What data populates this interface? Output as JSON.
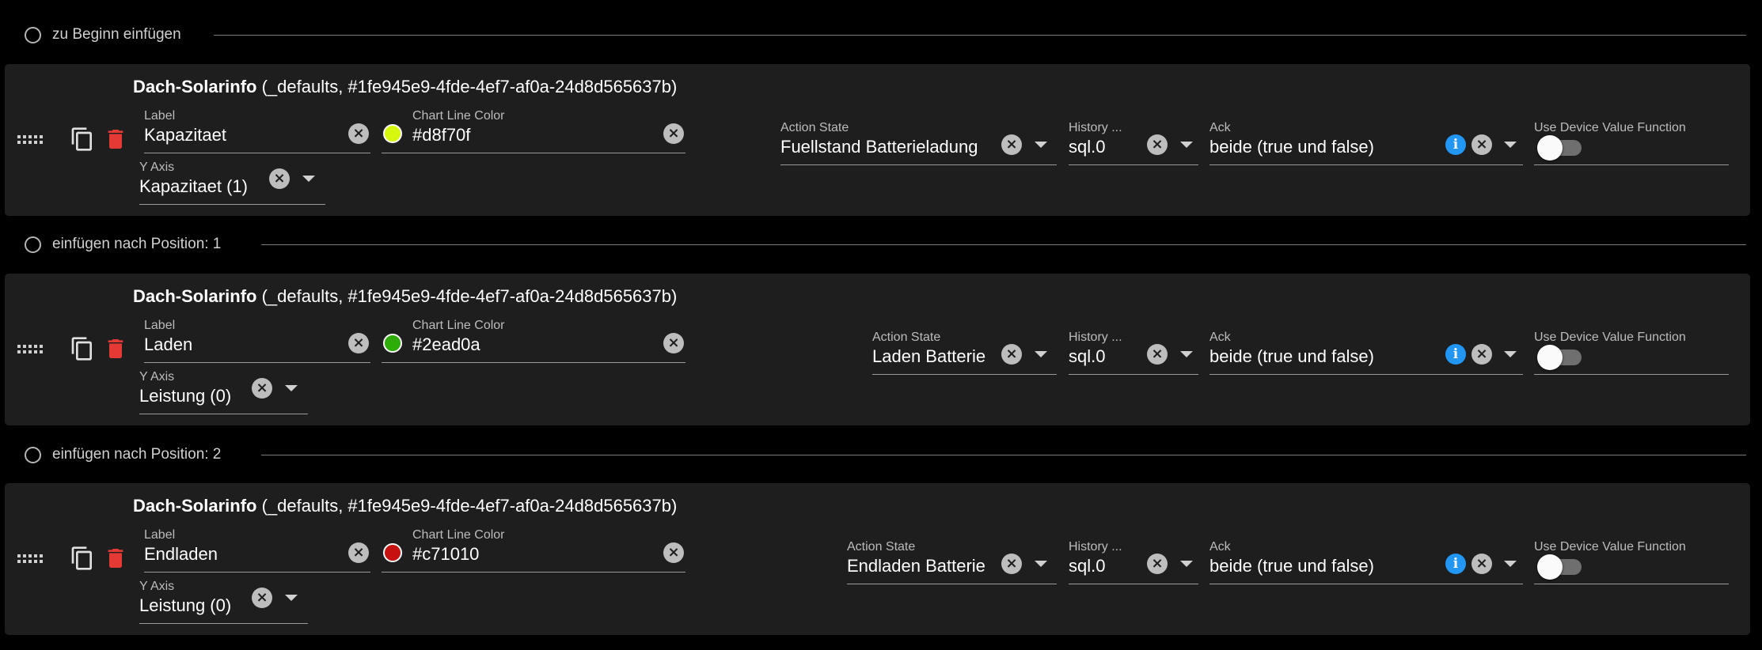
{
  "insert_rows": [
    {
      "label": "zu Beginn einfügen"
    },
    {
      "label": "einfügen nach Position: 1"
    },
    {
      "label": "einfügen nach Position: 2"
    }
  ],
  "cards": [
    {
      "title_name": "Dach-Solarinfo",
      "title_rest": " (_defaults, #1fe945e9-4fde-4ef7-af0a-24d8d565637b)",
      "label_caption": "Label",
      "label_value": "Kapazitaet",
      "color_caption": "Chart Line Color",
      "color_value": "#d8f70f",
      "yaxis_caption": "Y Axis",
      "yaxis_value": "Kapazitaet (1)",
      "action_caption": "Action State",
      "action_value": "Fuellstand Batterieladung",
      "history_caption": "History ...",
      "history_value": "sql.0",
      "ack_caption": "Ack",
      "ack_value": "beide (true und false)",
      "udvf_caption": "Use Device Value Function",
      "udvf_on": false
    },
    {
      "title_name": "Dach-Solarinfo",
      "title_rest": " (_defaults, #1fe945e9-4fde-4ef7-af0a-24d8d565637b)",
      "label_caption": "Label",
      "label_value": "Laden",
      "color_caption": "Chart Line Color",
      "color_value": "#2ead0a",
      "yaxis_caption": "Y Axis",
      "yaxis_value": "Leistung (0)",
      "action_caption": "Action State",
      "action_value": "Laden Batterie",
      "history_caption": "History ...",
      "history_value": "sql.0",
      "ack_caption": "Ack",
      "ack_value": "beide (true und false)",
      "udvf_caption": "Use Device Value Function",
      "udvf_on": false
    },
    {
      "title_name": "Dach-Solarinfo",
      "title_rest": " (_defaults, #1fe945e9-4fde-4ef7-af0a-24d8d565637b)",
      "label_caption": "Label",
      "label_value": "Endladen",
      "color_caption": "Chart Line Color",
      "color_value": "#c71010",
      "yaxis_caption": "Y Axis",
      "yaxis_value": "Leistung (0)",
      "action_caption": "Action State",
      "action_value": "Endladen Batterie",
      "history_caption": "History ...",
      "history_value": "sql.0",
      "ack_caption": "Ack",
      "ack_value": "beide (true und false)",
      "udvf_caption": "Use Device Value Function",
      "udvf_on": false
    }
  ],
  "icons": {
    "drag": "drag-handle-icon",
    "copy": "copy-icon",
    "delete": "delete-icon",
    "clear": "clear-icon",
    "dropdown": "dropdown-arrow-icon",
    "info": "info-icon"
  },
  "colors": {
    "delete_red": "#e53935",
    "info_blue": "#2196f3",
    "card_bg": "#1e1e1e"
  }
}
